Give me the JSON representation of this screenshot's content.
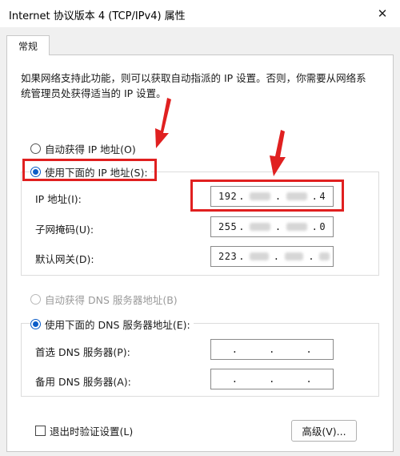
{
  "window": {
    "title": "Internet 协议版本 4 (TCP/IPv4) 属性",
    "close_glyph": "✕"
  },
  "tabs": [
    {
      "label": "常规"
    }
  ],
  "description": "如果网络支持此功能，则可以获取自动指派的 IP 设置。否则，你需要从网络系统管理员处获得适当的 IP 设置。",
  "ip_section": {
    "auto_label": "自动获得 IP 地址(O)",
    "manual_label": "使用下面的 IP 地址(S):",
    "fields": [
      {
        "label": "IP 地址(I):",
        "value_prefix": "192",
        "value_suffix": "4"
      },
      {
        "label": "子网掩码(U):",
        "value_prefix": "255",
        "value_suffix": "0"
      },
      {
        "label": "默认网关(D):",
        "value_prefix": "223",
        "value_suffix": ""
      }
    ]
  },
  "dns_section": {
    "auto_label": "自动获得 DNS 服务器地址(B)",
    "manual_label": "使用下面的 DNS 服务器地址(E):",
    "fields": [
      {
        "label": "首选 DNS 服务器(P):",
        "value": ".     .     ."
      },
      {
        "label": "备用 DNS 服务器(A):",
        "value": ".     .     ."
      }
    ]
  },
  "footer": {
    "validate_label": "退出时验证设置(L)",
    "advanced_button": "高级(V)..."
  },
  "colors": {
    "annotation_red": "#e02020",
    "radio_blue": "#0b5cc8"
  }
}
